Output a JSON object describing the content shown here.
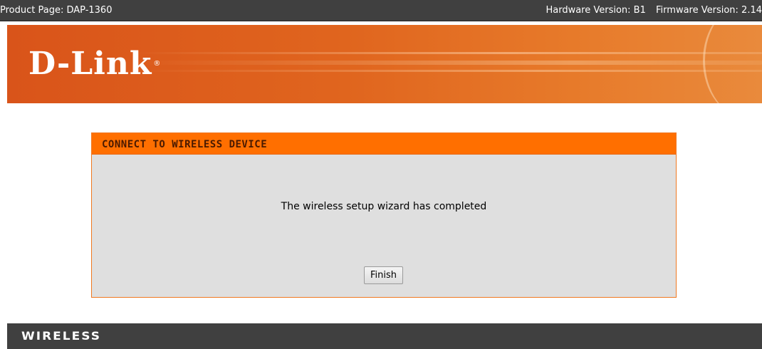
{
  "topbar": {
    "product_page": "Product Page: DAP-1360",
    "hardware_version": "Hardware Version: B1",
    "firmware_version": "Firmware Version: 2.14"
  },
  "brand": {
    "logo_text": "D-Link",
    "logo_reg": "®",
    "accent_color": "#ff6f00",
    "banner_color": "#e0651e"
  },
  "panel": {
    "title": "CONNECT TO WIRELESS DEVICE",
    "message": "The wireless setup wizard has completed",
    "finish_label": "Finish"
  },
  "footer": {
    "label": "WIRELESS"
  }
}
